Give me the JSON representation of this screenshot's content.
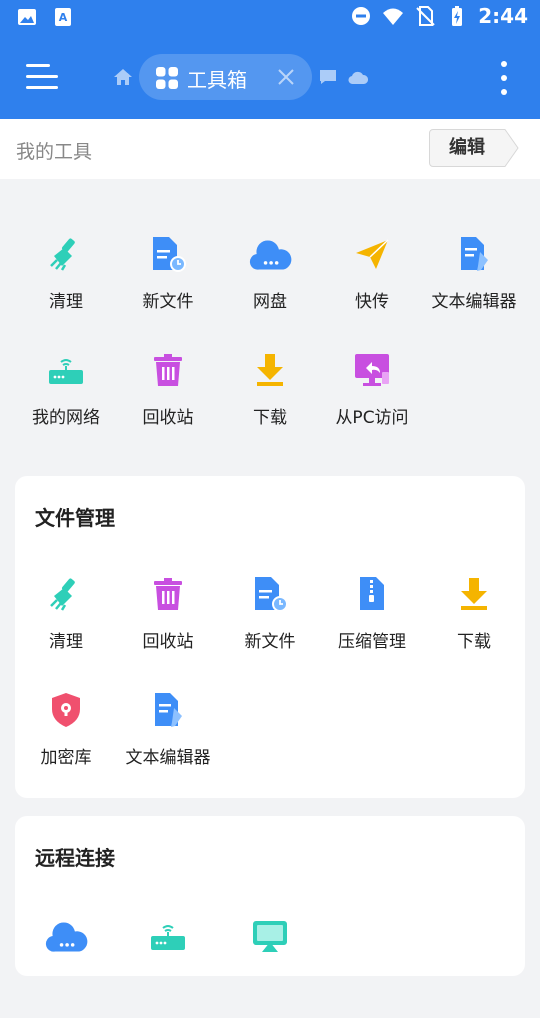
{
  "status_bar": {
    "time": "2:44",
    "left_icons": [
      "gallery-icon",
      "font-icon"
    ],
    "right_icons": [
      "dnd-icon",
      "wifi-icon",
      "no-sim-icon",
      "battery-charging-icon"
    ]
  },
  "app_bar": {
    "active_tab": "工具箱",
    "tabs_icons": [
      "home-icon",
      "chat-icon",
      "cloud-icon"
    ]
  },
  "my_tools": {
    "title": "我的工具",
    "edit_label": "编辑",
    "items": [
      {
        "label": "清理",
        "icon": "broom-icon"
      },
      {
        "label": "新文件",
        "icon": "new-file-icon"
      },
      {
        "label": "网盘",
        "icon": "cloud-drive-icon"
      },
      {
        "label": "快传",
        "icon": "paper-plane-icon"
      },
      {
        "label": "文本编辑器",
        "icon": "text-editor-icon"
      },
      {
        "label": "我的网络",
        "icon": "router-icon"
      },
      {
        "label": "回收站",
        "icon": "trash-icon"
      },
      {
        "label": "下载",
        "icon": "download-icon"
      },
      {
        "label": "从PC访问",
        "icon": "pc-access-icon"
      }
    ]
  },
  "file_management": {
    "title": "文件管理",
    "items": [
      {
        "label": "清理",
        "icon": "broom-icon"
      },
      {
        "label": "回收站",
        "icon": "trash-icon"
      },
      {
        "label": "新文件",
        "icon": "new-file-icon"
      },
      {
        "label": "压缩管理",
        "icon": "zip-icon"
      },
      {
        "label": "下载",
        "icon": "download-icon"
      },
      {
        "label": "加密库",
        "icon": "shield-lock-icon"
      },
      {
        "label": "文本编辑器",
        "icon": "text-editor-icon"
      }
    ]
  },
  "remote_connection": {
    "title": "远程连接",
    "items": [
      {
        "icon": "cloud-drive-icon"
      },
      {
        "icon": "router-icon"
      },
      {
        "icon": "cast-screen-icon"
      }
    ]
  },
  "colors": {
    "primary": "#2f80ed",
    "teal": "#2ecfb8",
    "purple": "#c84fe0",
    "yellow": "#f5b400",
    "red": "#f0506e",
    "blue": "#3e8ef7"
  }
}
